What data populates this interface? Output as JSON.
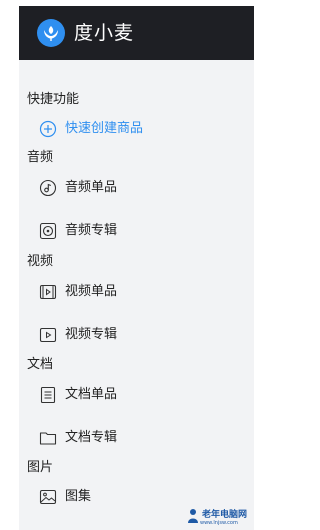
{
  "header": {
    "title": "度小麦",
    "logo_icon": "wheat-icon",
    "bg_color": "#1e1f24",
    "accent_color": "#2f8ff0"
  },
  "sidebar": {
    "bg_color": "#f2f3f5",
    "sections": [
      {
        "title": "快捷功能",
        "items": [
          {
            "label": "快速创建商品",
            "icon": "plus-circle-icon"
          }
        ]
      },
      {
        "title": "音频",
        "items": [
          {
            "label": "音频单品",
            "icon": "music-note-icon"
          },
          {
            "label": "音频专辑",
            "icon": "disc-icon"
          }
        ]
      },
      {
        "title": "视频",
        "items": [
          {
            "label": "视频单品",
            "icon": "film-icon"
          },
          {
            "label": "视频专辑",
            "icon": "play-box-icon"
          }
        ]
      },
      {
        "title": "文档",
        "items": [
          {
            "label": "文档单品",
            "icon": "document-icon"
          },
          {
            "label": "文档专辑",
            "icon": "folder-icon"
          }
        ]
      },
      {
        "title": "图片",
        "items": [
          {
            "label": "图集",
            "icon": "image-icon"
          }
        ]
      }
    ]
  },
  "watermark": {
    "text": "老年电脑网",
    "sub": "www.lnjsw.com"
  }
}
